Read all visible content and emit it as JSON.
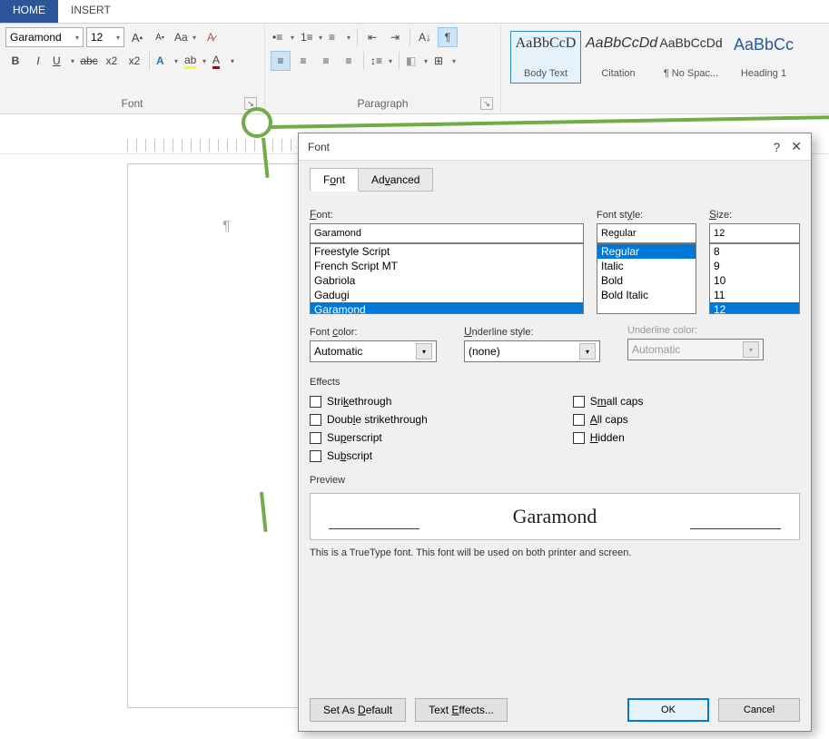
{
  "ribbon": {
    "tabs": {
      "home": "HOME",
      "insert": "INSERT"
    },
    "font_name": "Garamond",
    "font_size": "12",
    "group_font": "Font",
    "group_paragraph": "Paragraph"
  },
  "styles": {
    "body_text": {
      "preview": "AaBbCcD",
      "name": "Body Text"
    },
    "citation": {
      "preview": "AaBbCcDd",
      "name": "Citation"
    },
    "no_spac": {
      "preview": "AaBbCcDd",
      "name": "¶ No Spac..."
    },
    "heading1": {
      "preview": "AaBbCc",
      "name": "Heading 1"
    }
  },
  "dialog": {
    "title": "Font",
    "tab_font": "Font",
    "tab_advanced": "Advanced",
    "font_label": "Font:",
    "font_value": "Garamond",
    "font_list": [
      "Freestyle Script",
      "French Script MT",
      "Gabriola",
      "Gadugi",
      "Garamond"
    ],
    "style_label": "Font style:",
    "style_value": "Regular",
    "style_list": [
      "Regular",
      "Italic",
      "Bold",
      "Bold Italic"
    ],
    "size_label": "Size:",
    "size_value": "12",
    "size_list": [
      "8",
      "9",
      "10",
      "11",
      "12"
    ],
    "font_color_label": "Font color:",
    "font_color_value": "Automatic",
    "underline_style_label": "Underline style:",
    "underline_style_value": "(none)",
    "underline_color_label": "Underline color:",
    "underline_color_value": "Automatic",
    "effects_title": "Effects",
    "effects_left": [
      "Strikethrough",
      "Double strikethrough",
      "Superscript",
      "Subscript"
    ],
    "effects_right": [
      "Small caps",
      "All caps",
      "Hidden"
    ],
    "preview_title": "Preview",
    "preview_text": "Garamond",
    "preview_hint": "This is a TrueType font. This font will be used on both printer and screen.",
    "btn_default": "Set As Default",
    "btn_effects": "Text Effects...",
    "btn_ok": "OK",
    "btn_cancel": "Cancel"
  }
}
